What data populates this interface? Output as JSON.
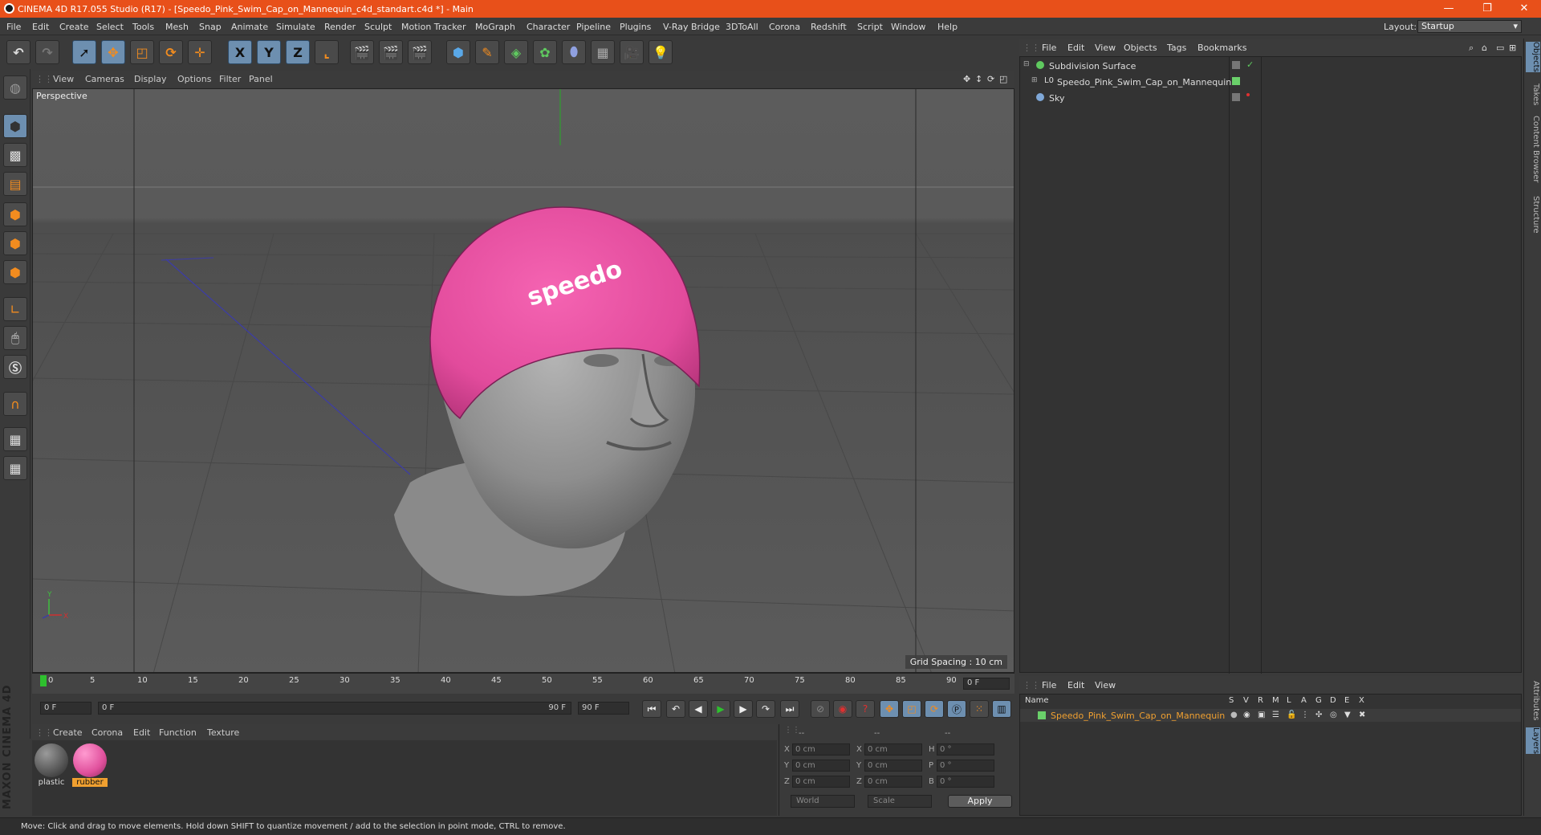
{
  "window": {
    "title": "CINEMA 4D R17.055 Studio (R17) - [Speedo_Pink_Swim_Cap_on_Mannequin_c4d_standart.c4d *] - Main",
    "controls": [
      "—",
      "❐",
      "✕"
    ]
  },
  "menubar": {
    "items": [
      "File",
      "Edit",
      "Create",
      "Select",
      "Tools",
      "Mesh",
      "Snap",
      "Animate",
      "Simulate",
      "Render",
      "Sculpt",
      "Motion Tracker",
      "MoGraph",
      "Character",
      "Pipeline",
      "Plugins",
      "V-Ray Bridge",
      "3DToAll",
      "Corona",
      "Redshift",
      "Script",
      "Window",
      "Help"
    ],
    "layout_label": "Layout:",
    "layout_value": "Startup"
  },
  "toolbar": {
    "axis_x": "X",
    "axis_y": "Y",
    "axis_z": "Z"
  },
  "viewport": {
    "menu": [
      "View",
      "Cameras",
      "Display",
      "Options",
      "Filter",
      "Panel"
    ],
    "label": "Perspective",
    "grid_spacing": "Grid Spacing : 10 cm",
    "cap_text": "speedo",
    "axis_y": "Y",
    "axis_x": "X",
    "colors": {
      "cap": "#ef4fa4",
      "head": "#9a9a9a",
      "background": "#5a5a5a"
    }
  },
  "timeline": {
    "ticks": [
      "0",
      "5",
      "10",
      "15",
      "20",
      "25",
      "30",
      "35",
      "40",
      "45",
      "50",
      "55",
      "60",
      "65",
      "70",
      "75",
      "80",
      "85",
      "90"
    ],
    "current_frame": "0 F",
    "start_field": "0 F",
    "range_start": "0 F",
    "range_end": "90 F",
    "end_field": "90 F"
  },
  "materials": {
    "menu": [
      "Create",
      "Corona",
      "Edit",
      "Function",
      "Texture"
    ],
    "items": [
      {
        "name": "plastic",
        "color": "#6a6a6a"
      },
      {
        "name": "rubber",
        "color": "#e0509c"
      }
    ]
  },
  "coordinates": {
    "header": [
      "--",
      "--",
      "--"
    ],
    "rows": [
      {
        "axis": "X",
        "pos": "0 cm",
        "axis2": "X",
        "size": "0 cm",
        "axis3": "H",
        "rot": "0 °"
      },
      {
        "axis": "Y",
        "pos": "0 cm",
        "axis2": "Y",
        "size": "0 cm",
        "axis3": "P",
        "rot": "0 °"
      },
      {
        "axis": "Z",
        "pos": "0 cm",
        "axis2": "Z",
        "size": "0 cm",
        "axis3": "B",
        "rot": "0 °"
      }
    ],
    "mode1": "World",
    "mode2": "Scale",
    "apply": "Apply"
  },
  "status": {
    "text": "Move: Click and drag to move elements. Hold down SHIFT to quantize movement / add to the selection in point mode, CTRL to remove."
  },
  "object_manager": {
    "menu": [
      "File",
      "Edit",
      "View",
      "Objects",
      "Tags",
      "Bookmarks"
    ],
    "objects": [
      {
        "name": "Subdivision Surface",
        "icon_color": "#5fc95f"
      },
      {
        "name": "Speedo_Pink_Swim_Cap_on_Mannequin",
        "icon_color": "#dddddd"
      },
      {
        "name": "Sky",
        "icon_color": "#7fa8d8"
      }
    ]
  },
  "layer_manager": {
    "menu": [
      "File",
      "Edit",
      "View"
    ],
    "header_name": "Name",
    "header_cols": [
      "S",
      "V",
      "R",
      "M",
      "L",
      "A",
      "G",
      "D",
      "E",
      "X"
    ],
    "layer": "Speedo_Pink_Swim_Cap_on_Mannequin",
    "layer_color": "#f0a030"
  },
  "right_tabs": [
    "Objects",
    "Takes",
    "Content Browser",
    "Structure",
    "Attributes",
    "Layers"
  ],
  "branding": "MAXON CINEMA 4D"
}
